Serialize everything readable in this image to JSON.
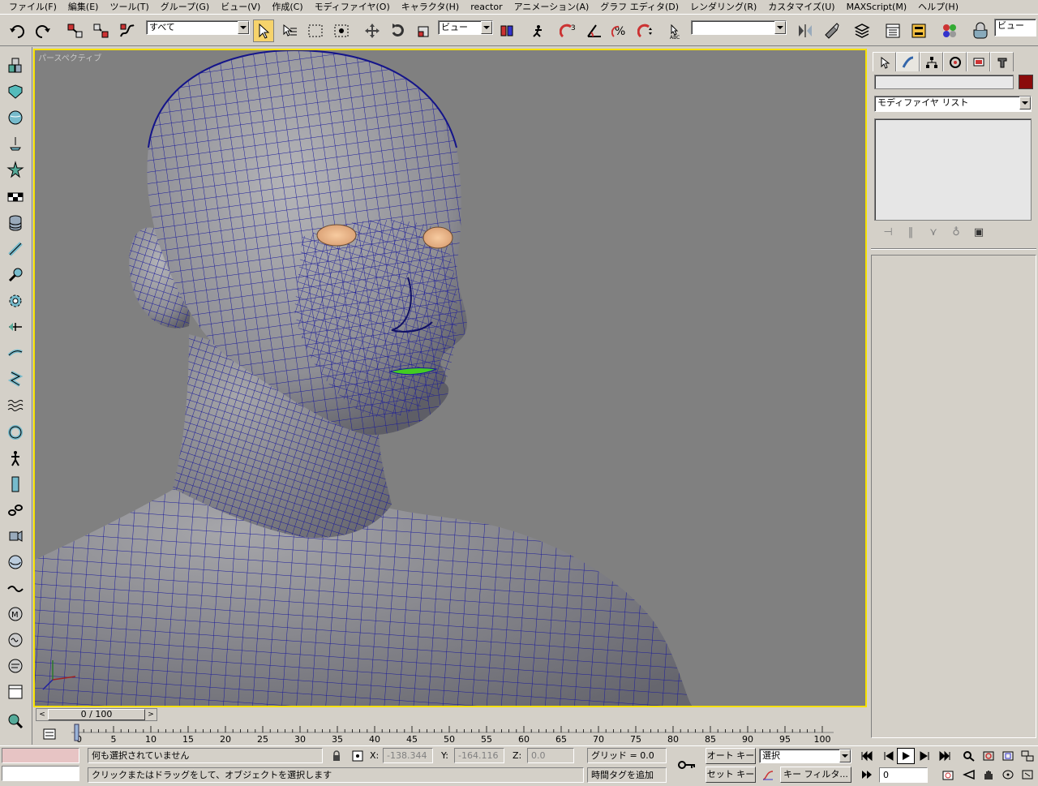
{
  "menu": [
    "ファイル(F)",
    "編集(E)",
    "ツール(T)",
    "グループ(G)",
    "ビュー(V)",
    "作成(C)",
    "モディファイヤ(O)",
    "キャラクタ(H)",
    "reactor",
    "アニメーション(A)",
    "グラフ エディタ(D)",
    "レンダリング(R)",
    "カスタマイズ(U)",
    "MAXScript(M)",
    "ヘルプ(H)"
  ],
  "toolbar": {
    "selection_filter": "すべて",
    "ref_coord": "ビュー",
    "named_selection": "",
    "view_dropdown": "ビュー",
    "icons": [
      "undo-icon",
      "redo-icon",
      "select-link-icon",
      "unlink-icon",
      "bind-space-warp-icon",
      "select-object-icon",
      "select-by-name-icon",
      "rect-select-region-icon",
      "window-crossing-icon",
      "move-icon",
      "rotate-icon",
      "scale-icon",
      "use-pivot-center-icon",
      "manipulate-icon",
      "snap-3d-icon",
      "angle-snap-icon",
      "percent-snap-icon",
      "spinner-snap-icon",
      "edit-named-selection-icon",
      "mirror-icon",
      "align-icon",
      "layer-manager-icon",
      "curve-editor-icon",
      "schematic-view-icon",
      "material-editor-icon",
      "render-scene-icon",
      "quick-render-icon"
    ]
  },
  "viewport": {
    "label": "パースペクティブ"
  },
  "command_panel": {
    "tabs": [
      "create-tab-icon",
      "modify-tab-icon",
      "hierarchy-tab-icon",
      "motion-tab-icon",
      "display-tab-icon",
      "utilities-tab-icon"
    ],
    "object_name": "",
    "object_color": "#8a0b0b",
    "modifier_list": "モディファイヤ リスト"
  },
  "timeslider": {
    "label": "0 / 100",
    "prev": "<",
    "next": ">"
  },
  "trackbar": {
    "ticks": [
      "0",
      "5",
      "10",
      "15",
      "20",
      "25",
      "30",
      "35",
      "40",
      "45",
      "50",
      "55",
      "60",
      "65",
      "70",
      "75",
      "80",
      "85",
      "90",
      "95",
      "100"
    ]
  },
  "status": {
    "selection_info": "何も選択されていません",
    "prompt": "クリックまたはドラッグをして、オブジェクトを選択します",
    "x_label": "X:",
    "x_value": "-138.344",
    "y_label": "Y:",
    "y_value": "-164.116",
    "z_label": "Z:",
    "z_value": "0.0",
    "grid": "グリッド = 0.0",
    "add_time_tag": "時間タグを追加",
    "auto_key": "オート キー",
    "set_key": "セット キー",
    "key_mode": "選択",
    "key_filters": "キー フィルタ...",
    "current_frame": "0"
  }
}
